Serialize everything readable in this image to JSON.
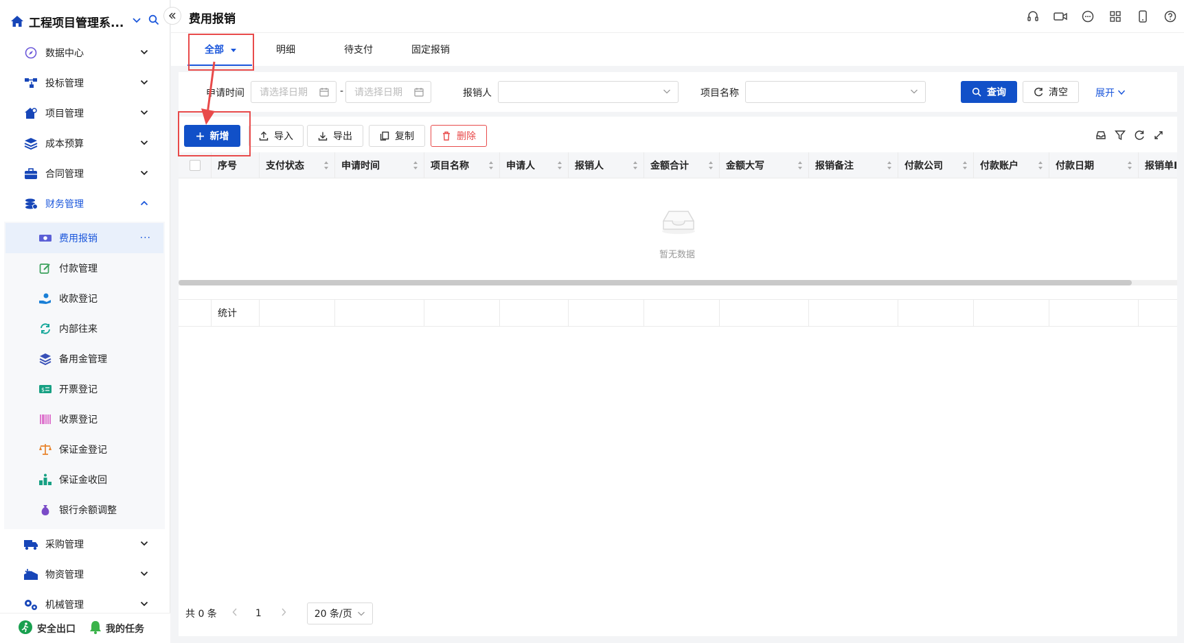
{
  "app": {
    "title": "工程项目管理系..."
  },
  "sidebar": {
    "items": [
      {
        "label": "数据中心",
        "icon": "compass-icon"
      },
      {
        "label": "投标管理",
        "icon": "flow-icon"
      },
      {
        "label": "项目管理",
        "icon": "house-gear-icon"
      },
      {
        "label": "成本预算",
        "icon": "layers-icon"
      },
      {
        "label": "合同管理",
        "icon": "briefcase-icon"
      },
      {
        "label": "财务管理",
        "icon": "coins-icon"
      }
    ],
    "finance_sub": [
      {
        "label": "费用报销",
        "icon": "cash-icon",
        "more": "···"
      },
      {
        "label": "付款管理",
        "icon": "edit-icon"
      },
      {
        "label": "收款登记",
        "icon": "hand-coin-icon"
      },
      {
        "label": "内部往来",
        "icon": "refresh-icon"
      },
      {
        "label": "备用金管理",
        "icon": "stack-icon"
      },
      {
        "label": "开票登记",
        "icon": "invoice-icon"
      },
      {
        "label": "收票登记",
        "icon": "barcode-icon"
      },
      {
        "label": "保证金登记",
        "icon": "scale-icon"
      },
      {
        "label": "保证金收回",
        "icon": "podium-icon"
      },
      {
        "label": "银行余额调整",
        "icon": "money-bag-icon"
      }
    ],
    "bottom_items": [
      {
        "label": "采购管理",
        "icon": "truck-icon"
      },
      {
        "label": "物资管理",
        "icon": "warehouse-icon"
      },
      {
        "label": "机械管理",
        "icon": "gears-icon"
      }
    ],
    "footer": {
      "exit": "安全出口",
      "tasks": "我的任务"
    }
  },
  "header": {
    "title": "费用报销"
  },
  "tabs": [
    "全部",
    "明细",
    "待支付",
    "固定报销"
  ],
  "filters": {
    "apply_time_label": "申请时间",
    "date_placeholder_start": "请选择日期",
    "date_sep": "-",
    "date_placeholder_end": "请选择日期",
    "reimburser_label": "报销人",
    "project_label": "项目名称",
    "query": "查询",
    "clear": "清空",
    "expand": "展开"
  },
  "toolbar": {
    "add": "新增",
    "import": "导入",
    "export": "导出",
    "copy": "复制",
    "delete": "删除"
  },
  "table": {
    "columns": [
      "序号",
      "支付状态",
      "申请时间",
      "项目名称",
      "申请人",
      "报销人",
      "金额合计",
      "金额大写",
      "报销备注",
      "付款公司",
      "付款账户",
      "付款日期",
      "报销单ID"
    ],
    "empty_text": "暂无数据",
    "summary_label": "统计"
  },
  "pager": {
    "total": "共 0 条",
    "page": "1",
    "page_size": "20 条/页"
  },
  "colors": {
    "primary": "#1150c8",
    "danger": "#e84a4a",
    "active_bg": "#e9f0fb"
  }
}
